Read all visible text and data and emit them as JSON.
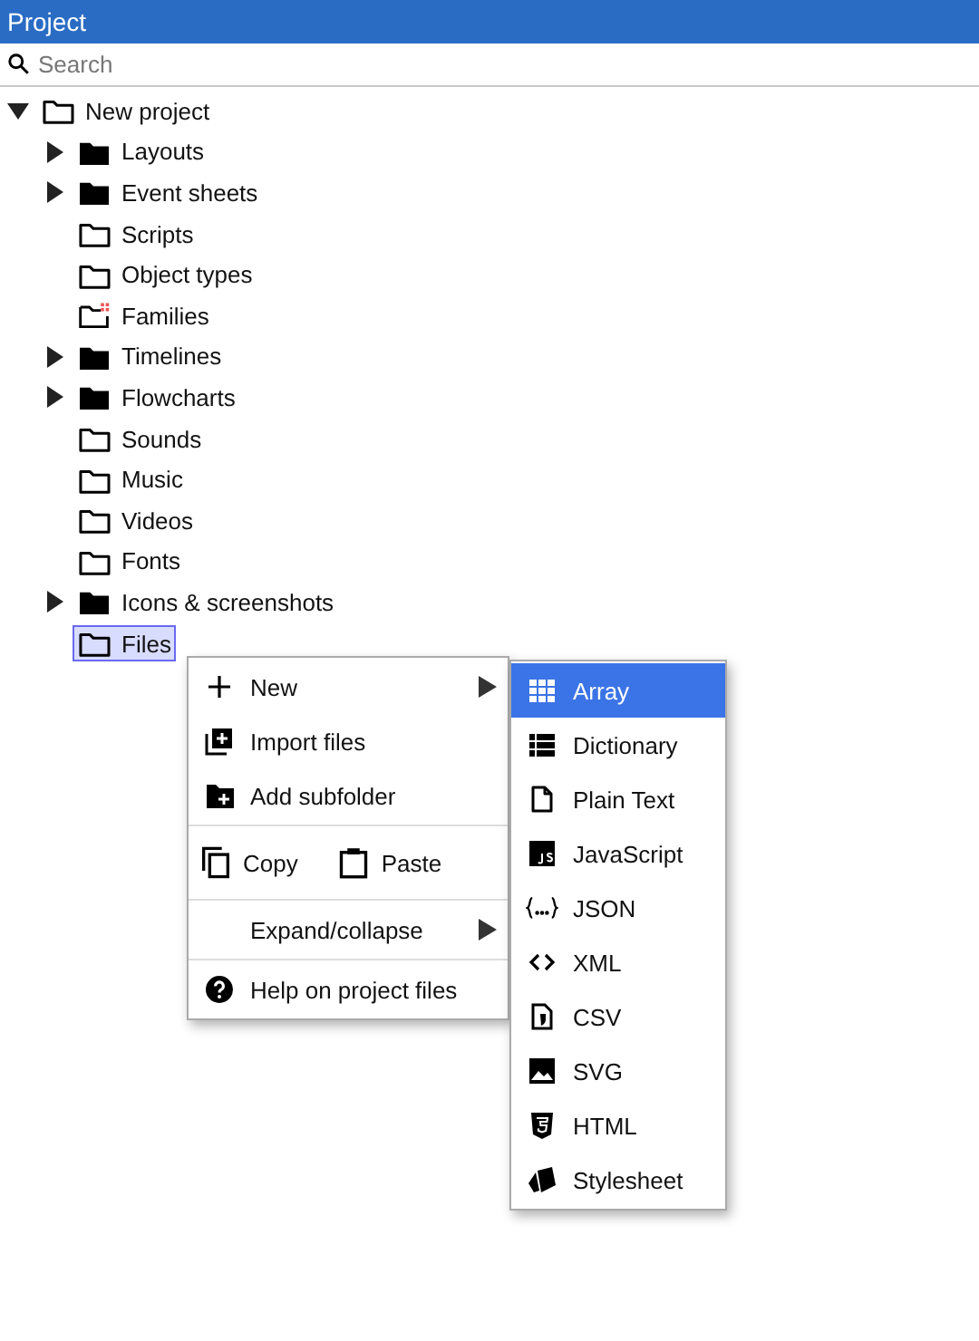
{
  "panel": {
    "title": "Project"
  },
  "search": {
    "placeholder": "Search"
  },
  "tree": [
    {
      "label": "New project",
      "kind": "outline",
      "expanded": true,
      "selected": false,
      "children": [
        {
          "label": "Layouts",
          "kind": "filled",
          "expanded": false,
          "selected": false
        },
        {
          "label": "Event sheets",
          "kind": "filled",
          "expanded": false,
          "selected": false
        },
        {
          "label": "Scripts",
          "kind": "outline",
          "selected": false
        },
        {
          "label": "Object types",
          "kind": "outline",
          "selected": false
        },
        {
          "label": "Families",
          "kind": "family",
          "selected": false
        },
        {
          "label": "Timelines",
          "kind": "filled",
          "expanded": false,
          "selected": false
        },
        {
          "label": "Flowcharts",
          "kind": "filled",
          "expanded": false,
          "selected": false
        },
        {
          "label": "Sounds",
          "kind": "outline",
          "selected": false
        },
        {
          "label": "Music",
          "kind": "outline",
          "selected": false
        },
        {
          "label": "Videos",
          "kind": "outline",
          "selected": false
        },
        {
          "label": "Fonts",
          "kind": "outline",
          "selected": false
        },
        {
          "label": "Icons & screenshots",
          "kind": "filled",
          "expanded": false,
          "selected": false
        },
        {
          "label": "Files",
          "kind": "outline",
          "selected": true
        }
      ]
    }
  ],
  "context_menu": {
    "items": [
      {
        "kind": "new",
        "label": "New",
        "submenu": true,
        "selected": false
      },
      {
        "kind": "import",
        "label": "Import files",
        "selected": false
      },
      {
        "kind": "subfolder",
        "label": "Add subfolder",
        "selected": false
      },
      {
        "kind": "separator"
      },
      {
        "kind": "clipboard",
        "parts": [
          {
            "label": "Copy"
          },
          {
            "label": "Paste"
          }
        ]
      },
      {
        "kind": "separator"
      },
      {
        "kind": "expand",
        "label": "Expand/collapse",
        "submenu": true,
        "selected": false
      },
      {
        "kind": "separator"
      },
      {
        "kind": "help",
        "label": "Help on project files",
        "selected": false
      }
    ]
  },
  "submenu": {
    "items": [
      {
        "kind": "array",
        "label": "Array",
        "selected": true
      },
      {
        "kind": "dictionary",
        "label": "Dictionary",
        "selected": false
      },
      {
        "kind": "text",
        "label": "Plain Text",
        "selected": false
      },
      {
        "kind": "javascript",
        "label": "JavaScript",
        "selected": false
      },
      {
        "kind": "json",
        "label": "JSON",
        "selected": false
      },
      {
        "kind": "xml",
        "label": "XML",
        "selected": false
      },
      {
        "kind": "csv",
        "label": "CSV",
        "selected": false
      },
      {
        "kind": "svg",
        "label": "SVG",
        "selected": false
      },
      {
        "kind": "html",
        "label": "HTML",
        "selected": false
      },
      {
        "kind": "stylesheet",
        "label": "Stylesheet",
        "selected": false
      }
    ]
  }
}
